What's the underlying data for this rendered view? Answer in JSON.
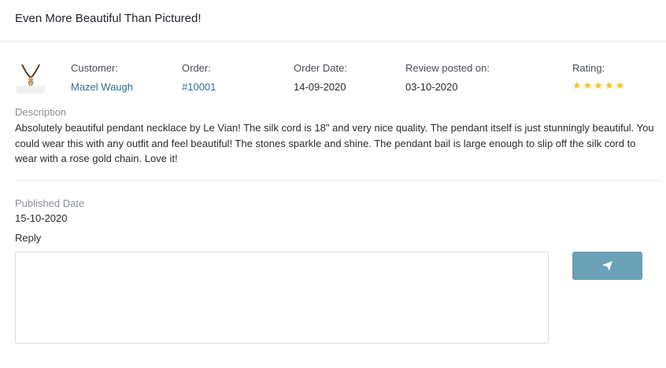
{
  "review": {
    "title": "Even More Beautiful Than Pictured!",
    "customer_label": "Customer:",
    "customer_name": "Mazel Waugh",
    "order_label": "Order:",
    "order_number": "#10001",
    "order_date_label": "Order Date:",
    "order_date": "14-09-2020",
    "review_posted_label": "Review posted on:",
    "review_posted_date": "03-10-2020",
    "rating_label": "Rating:",
    "rating": 5,
    "rating_max": 5,
    "stars_text": "★★★★★",
    "description_label": "Description",
    "description": "Absolutely beautiful pendant necklace by Le Vian! The silk cord is 18\" and very nice quality. The pendant itself is just stunningly beautiful. You could wear this with any outfit and feel beautiful! The stones sparkle and shine. The pendant bail is large enough to slip off the silk cord to wear with a rose gold chain. Love it!",
    "published_label": "Published Date",
    "published_date": "15-10-2020",
    "reply_label": "Reply"
  },
  "icons": {
    "product": "pendant-necklace-thumbnail",
    "send": "paper-plane-icon"
  },
  "colors": {
    "link": "#2f6f8f",
    "star": "#f7c518",
    "send_button": "#6aa1b7"
  }
}
